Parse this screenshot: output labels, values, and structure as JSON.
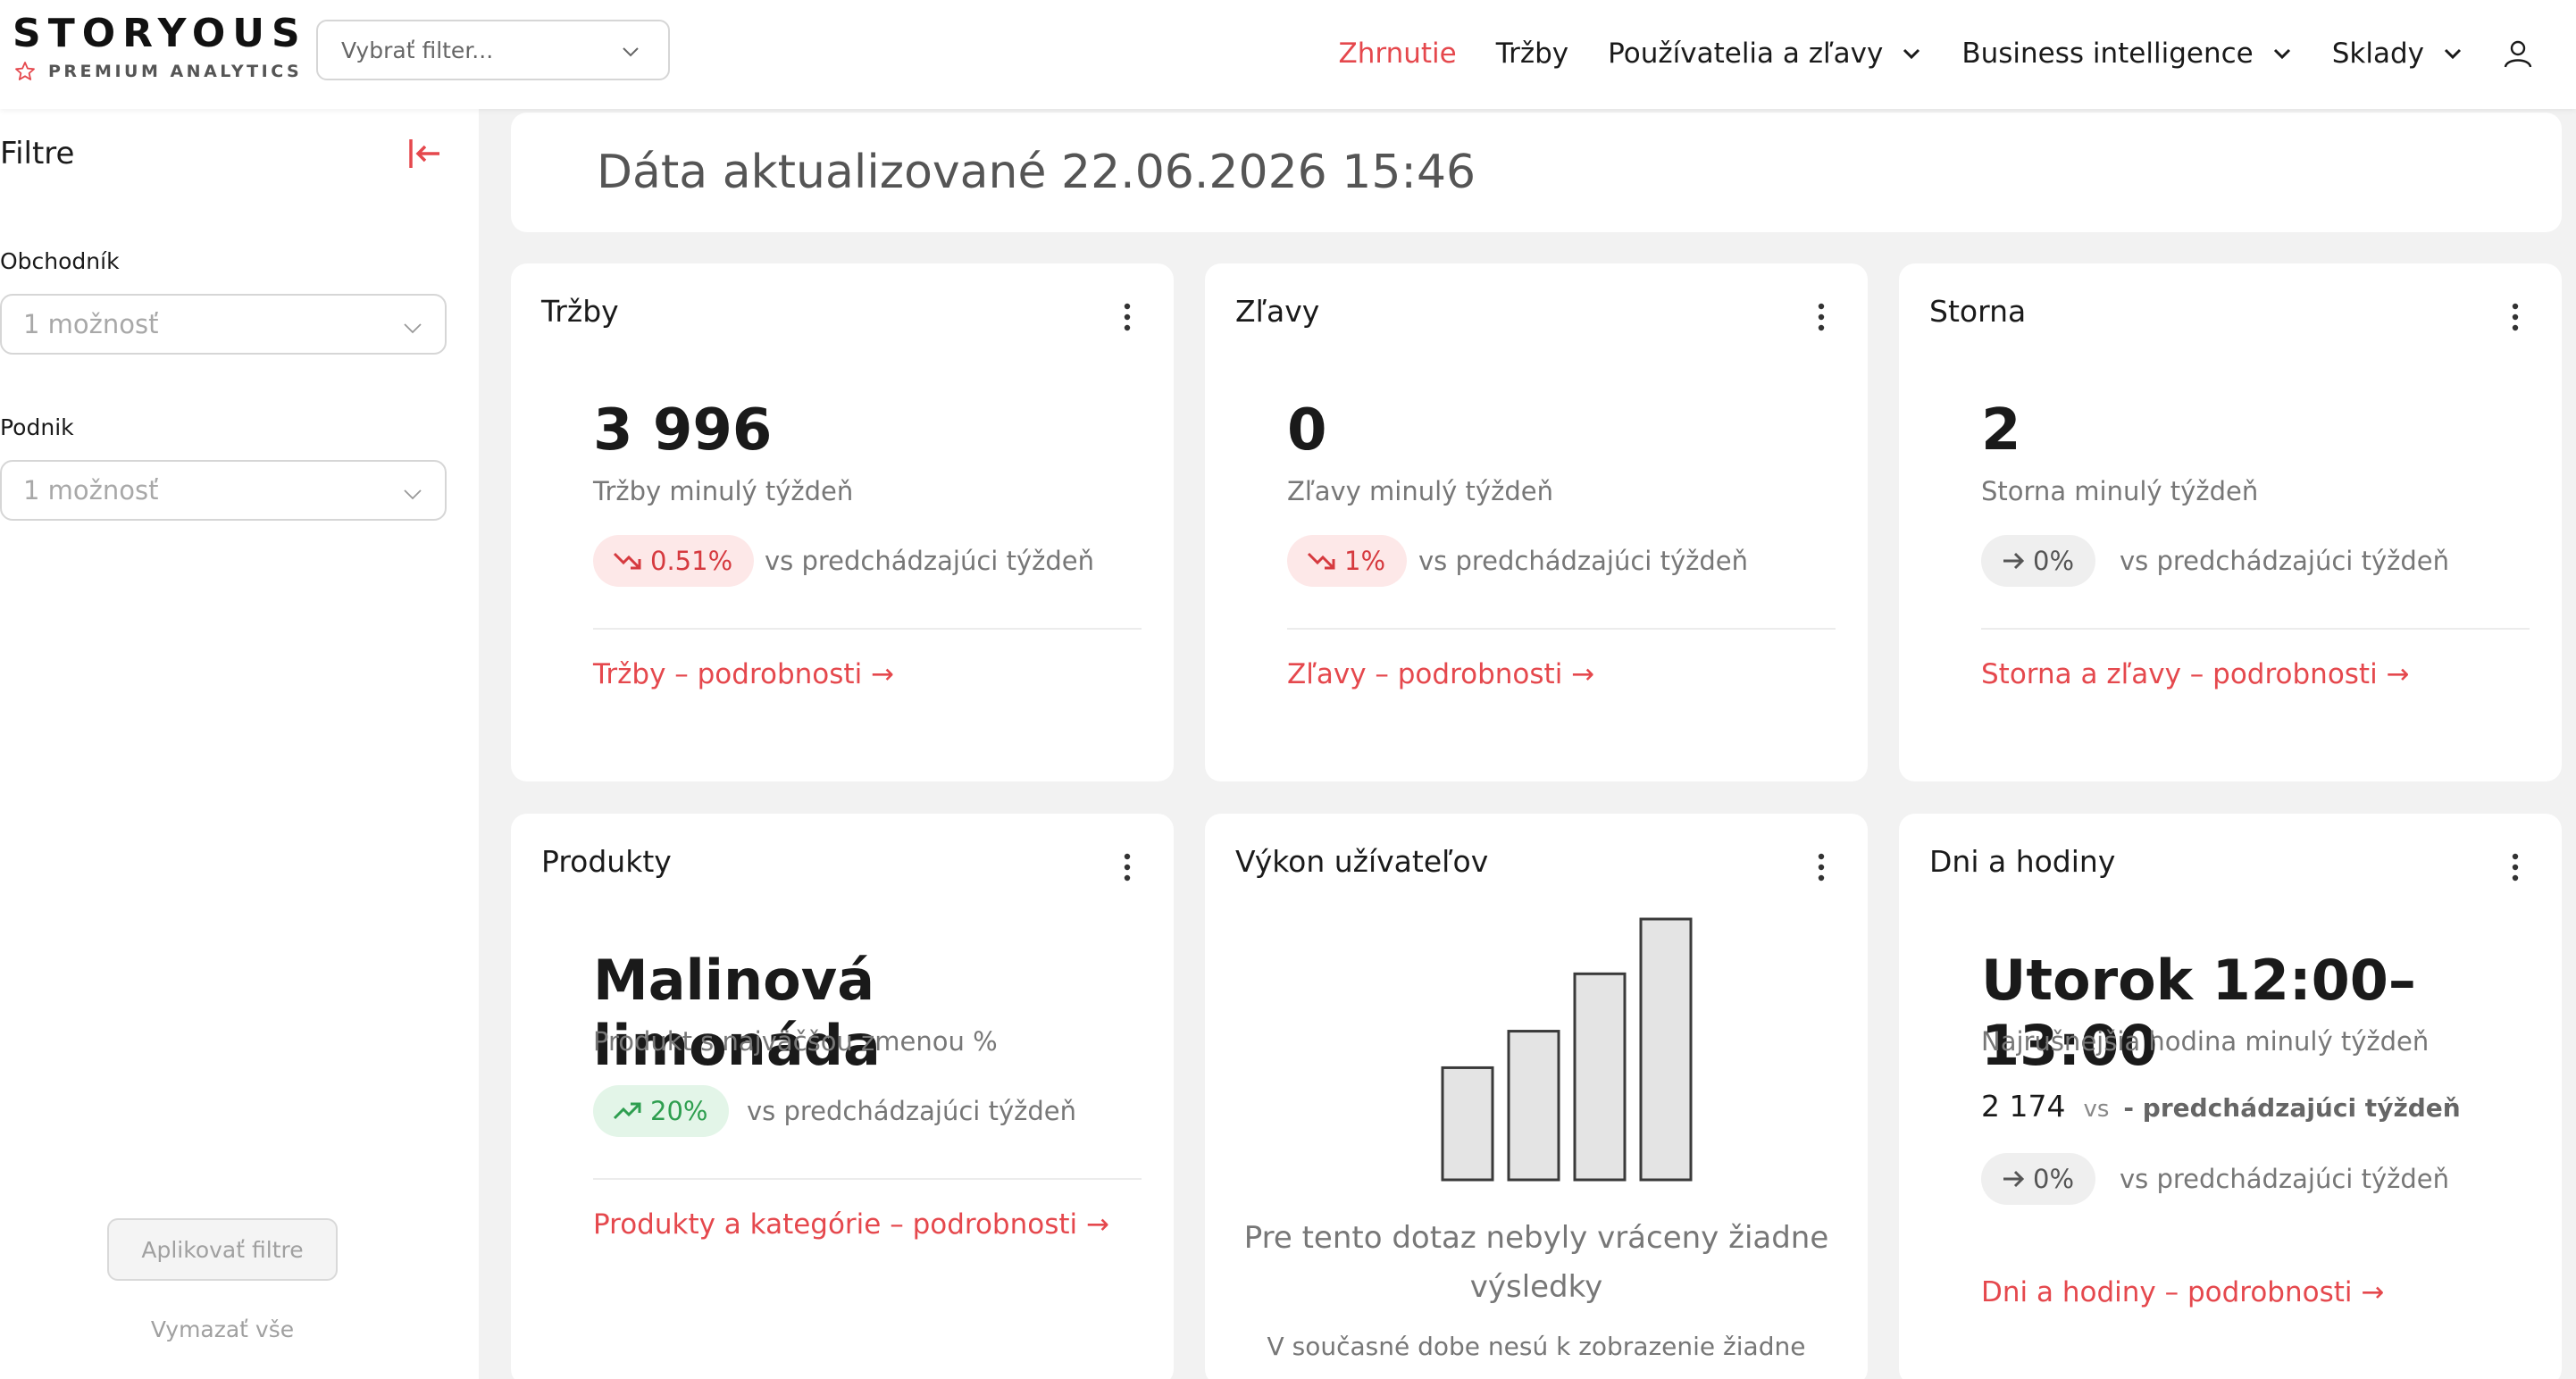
{
  "header": {
    "brand": "STORYOUS",
    "brand_sub": "PREMIUM ANALYTICS",
    "filter_placeholder": "Vybrať filter...",
    "nav": [
      {
        "label": "Zhrnutie",
        "active": true
      },
      {
        "label": "Tržby"
      },
      {
        "label": "Používatelia a zľavy",
        "dropdown": true
      },
      {
        "label": "Business intelligence",
        "dropdown": true
      },
      {
        "label": "Sklady",
        "dropdown": true
      }
    ],
    "icons": {
      "user": "user-icon",
      "chevron": "chevron-down-icon",
      "star": "star-icon"
    }
  },
  "sidebar": {
    "title": "Filtre",
    "collapse_icon": "collapse-left-icon",
    "merchant_label": "Obchodník",
    "merchant_value": "1 možnosť",
    "venue_label": "Podnik",
    "venue_value": "1 možnosť",
    "apply_label": "Aplikovať filtre",
    "clear_label": "Vymazať vše"
  },
  "main": {
    "updated_text": "Dáta aktualizované 22.06.2026 15:46",
    "cards": {
      "revenue": {
        "title": "Tržby",
        "value": "3 996",
        "subtitle": "Tržby minulý týždeň",
        "change": "0.51%",
        "trend": "down",
        "vs": "vs predchádzajúci týždeň",
        "link": "Tržby – podrobnosti →"
      },
      "discounts": {
        "title": "Zľavy",
        "value": "0",
        "subtitle": "Zľavy minulý týždeň",
        "change": "1%",
        "trend": "down",
        "vs": "vs predchádzajúci týždeň",
        "link": "Zľavy – podrobnosti →"
      },
      "cancellations": {
        "title": "Storna",
        "value": "2",
        "subtitle": "Storna minulý týždeň",
        "change": "0%",
        "trend": "flat",
        "vs": "vs predchádzajúci týždeň",
        "link": "Storna a zľavy – podrobnosti →"
      },
      "products": {
        "title": "Produkty",
        "value": "Malinová limonáda",
        "subtitle": "Produkt s najväčšou zmenou %",
        "change": "20%",
        "trend": "up",
        "vs": "vs predchádzajúci týždeň",
        "link": "Produkty a kategórie – podrobnosti →"
      },
      "user_performance": {
        "title": "Výkon užívateľov",
        "empty_title": "Pre tento dotaz nebyly vráceny žiadne výsledky",
        "empty_text": "V současné dobe nesú k zobrazenie žiadne",
        "placeholder_bars": [
          0.43,
          0.57,
          0.79,
          1.0
        ]
      },
      "days_hours": {
        "title": "Dni a hodiny",
        "value": "Utorok 12:00–13:00",
        "subtitle": "Najrušnejšia hodina minulý týždeň",
        "count": "2 174",
        "count_vs": "vs",
        "count_prev": "- predchádzajúci týždeň",
        "change": "0%",
        "trend": "flat",
        "vs": "vs predchádzajúci týždeň",
        "link": "Dni a hodiny – podrobnosti →"
      }
    }
  },
  "colors": {
    "accent": "#e5484d",
    "down_bg": "#fde8e8",
    "up_bg": "#e3f5e8",
    "up_text": "#2e9e4f",
    "flat_bg": "#efefef",
    "page_bg": "#f2f2f2"
  }
}
